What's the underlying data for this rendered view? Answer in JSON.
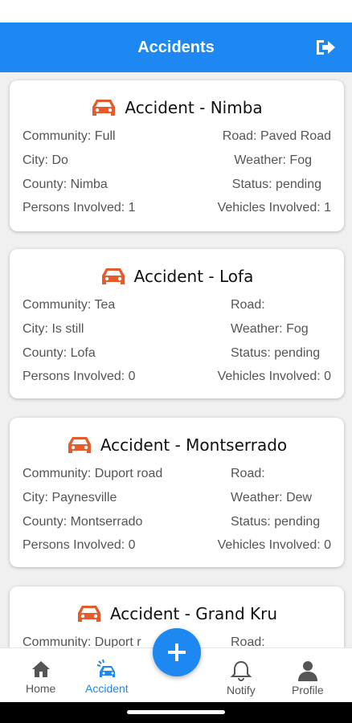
{
  "header": {
    "title": "Accidents"
  },
  "colors": {
    "primary": "#1e88f2",
    "car_icon": "#e65a2b"
  },
  "accidents": [
    {
      "title": "Accident - Nimba",
      "community": "Community: Full",
      "road": "Road: Paved Road",
      "city": "City: Do",
      "weather": "Weather: Fog",
      "county": "County: Nimba",
      "status": "Status: pending",
      "persons": "Persons Involved: 1",
      "vehicles": "Vehicles Involved: 1"
    },
    {
      "title": "Accident - Lofa",
      "community": "Community: Tea",
      "road": "Road:",
      "city": "City: Is still",
      "weather": "Weather: Fog",
      "county": "County: Lofa",
      "status": "Status: pending",
      "persons": "Persons Involved: 0",
      "vehicles": "Vehicles Involved: 0"
    },
    {
      "title": "Accident - Montserrado",
      "community": "Community: Duport road",
      "road": "Road:",
      "city": "City: Paynesville",
      "weather": "Weather: Dew",
      "county": "County: Montserrado",
      "status": "Status: pending",
      "persons": "Persons Involved: 0",
      "vehicles": "Vehicles Involved: 0"
    },
    {
      "title": "Accident - Grand Kru",
      "community": "Community: Duport r",
      "road": "Road:"
    }
  ],
  "nav": {
    "home": "Home",
    "accident": "Accident",
    "notify": "Notify",
    "profile": "Profile"
  }
}
